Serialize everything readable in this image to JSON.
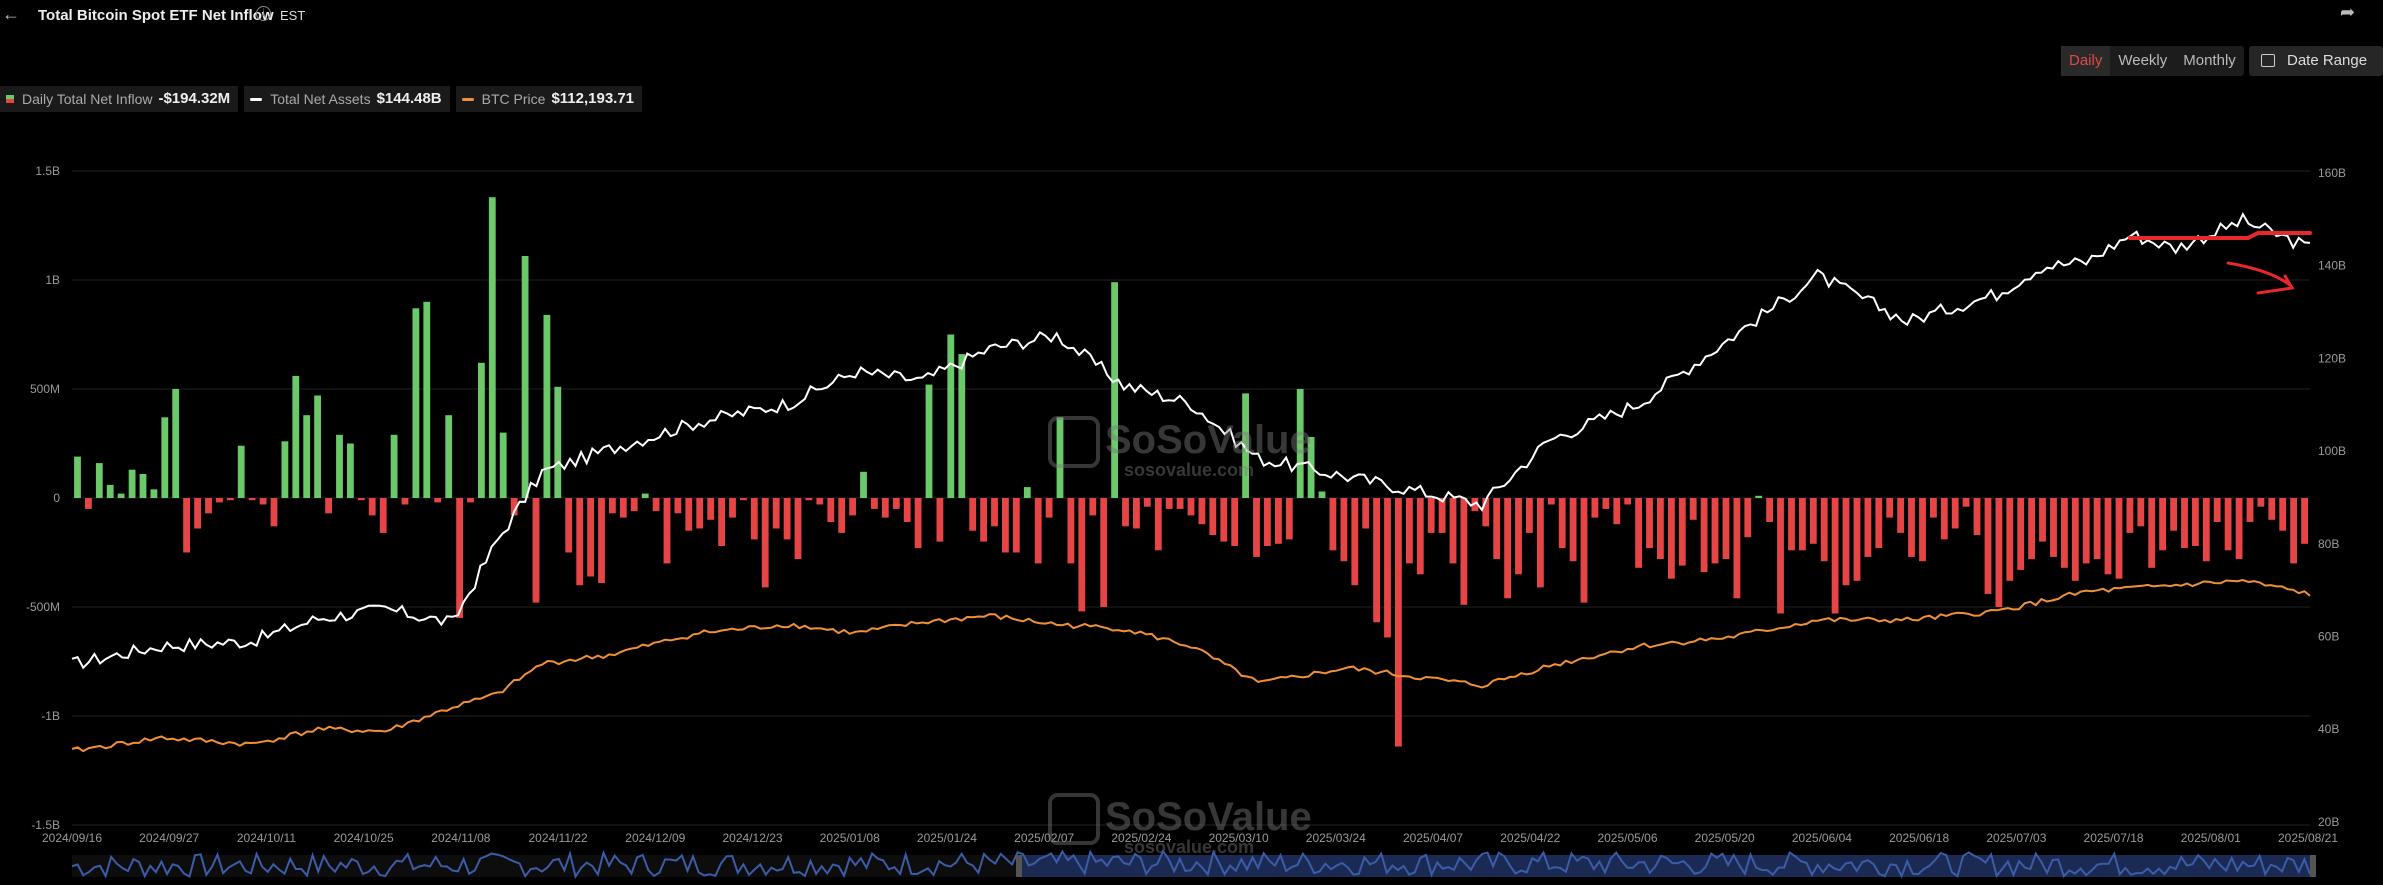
{
  "header": {
    "title": "Total Bitcoin Spot ETF Net Inflow",
    "timezone": "EST",
    "back_icon": "arrow-left-icon",
    "info_icon": "info-icon",
    "share_icon": "share-icon"
  },
  "tabs": [
    {
      "label": "Daily",
      "active": true
    },
    {
      "label": "Weekly",
      "active": false
    },
    {
      "label": "Monthly",
      "active": false
    }
  ],
  "date_range": {
    "label": "Date Range",
    "icon": "calendar-icon"
  },
  "legend": [
    {
      "label": "Daily Total Net Inflow",
      "value": "-$194.32M",
      "color": "#6cc96a"
    },
    {
      "label": "Total Net Assets",
      "value": "$144.48B",
      "color": "#ffffff"
    },
    {
      "label": "BTC Price",
      "value": "$112,193.71",
      "color": "#f0913a"
    }
  ],
  "watermark": {
    "brand": "SoSoValue",
    "url": "sosovalue.com"
  },
  "colors": {
    "positive": "#6cc96a",
    "negative": "#e64545",
    "assets": "#ffffff",
    "price": "#f0913a",
    "annotation": "#e8282a"
  },
  "chart_data": {
    "type": "bar",
    "title": "Total Bitcoin Spot ETF Net Inflow",
    "x_tick_labels": [
      "2024/09/16",
      "2024/09/27",
      "2024/10/11",
      "2024/10/25",
      "2024/11/08",
      "2024/11/22",
      "2024/12/09",
      "2024/12/23",
      "2025/01/08",
      "2025/01/24",
      "2025/02/07",
      "2025/02/24",
      "2025/03/10",
      "2025/03/24",
      "2025/04/07",
      "2025/04/22",
      "2025/05/06",
      "2025/05/20",
      "2025/06/04",
      "2025/06/18",
      "2025/07/03",
      "2025/07/18",
      "2025/08/01",
      "2025/08/21"
    ],
    "y_left": {
      "ticks": [
        "1.5B",
        "1B",
        "500M",
        "0",
        "-500M",
        "-1B",
        "-1.5B"
      ],
      "range": [
        -1500,
        1500
      ],
      "unit": "M USD"
    },
    "y_right": {
      "ticks": [
        "160B",
        "140B",
        "120B",
        "100B",
        "80B",
        "60B",
        "40B",
        "20B"
      ],
      "range": [
        20,
        160
      ],
      "unit": "B USD"
    },
    "series": [
      {
        "name": "Daily Total Net Inflow",
        "kind": "bar",
        "values": [
          190,
          -50,
          160,
          60,
          20,
          130,
          110,
          40,
          370,
          500,
          -250,
          -140,
          -70,
          -20,
          -10,
          240,
          -10,
          -30,
          -130,
          260,
          560,
          380,
          470,
          -70,
          290,
          250,
          -10,
          -80,
          -160,
          290,
          -30,
          870,
          900,
          -20,
          380,
          -550,
          -20,
          620,
          1380,
          300,
          -80,
          1110,
          -480,
          840,
          510,
          -250,
          -400,
          -360,
          -390,
          -70,
          -90,
          -60,
          20,
          -60,
          -300,
          -70,
          -150,
          -140,
          -100,
          -220,
          -90,
          -10,
          -190,
          -410,
          -140,
          -190,
          -280,
          -10,
          -30,
          -110,
          -160,
          -80,
          120,
          -50,
          -90,
          -50,
          -110,
          -230,
          520,
          -200,
          750,
          660,
          -150,
          -200,
          -130,
          -250,
          -250,
          50,
          -300,
          -90,
          370,
          -300,
          -520,
          -80,
          -500,
          990,
          -130,
          -140,
          -40,
          -240,
          -50,
          -50,
          -80,
          -120,
          -170,
          -200,
          -220,
          480,
          -270,
          -220,
          -210,
          -190,
          500,
          280,
          30,
          -240,
          -290,
          -400,
          -140,
          -570,
          -640,
          -1140,
          -300,
          -350,
          -160,
          -160,
          -300,
          -490,
          -60,
          -130,
          -280,
          -460,
          -350,
          -160,
          -410,
          -30,
          -230,
          -290,
          -480,
          -90,
          -50,
          -120,
          -30,
          -320,
          -230,
          -280,
          -370,
          -310,
          -100,
          -340,
          -300,
          -280,
          -460,
          -180,
          10,
          -110,
          -530,
          -240,
          -240,
          -210,
          -290,
          -530,
          -400,
          -380,
          -270,
          -230,
          -90,
          -160,
          -270,
          -290,
          -90,
          -190,
          -140,
          -40,
          -170,
          -440,
          -500,
          -380,
          -330,
          -280,
          -200,
          -270,
          -320,
          -380,
          -300,
          -280,
          -350,
          -370,
          -160,
          -130,
          -320,
          -240,
          -150,
          -230,
          -220,
          -290,
          -110,
          -240,
          -280,
          -110,
          -40,
          -100,
          -150,
          -300,
          -210
        ],
        "note": "values in millions USD; approximate reading of bars"
      },
      {
        "name": "Total Net Assets",
        "kind": "line",
        "axis": "right",
        "summary": "rises from ~53B (Sep 2024) to ~125B (late Jan 2025), dips to ~90B (early Apr 2025), climbs to ~155B (mid Aug 2025), ends ~144B"
      },
      {
        "name": "BTC Price",
        "kind": "line",
        "axis": "left-scaled",
        "summary": "rises from ~$58K (Sep 2024) to ~$106K (Jan 2025), dips to ~$77K (Apr 2025), peaks ~$123K (Aug 2025), ends ~$112K"
      }
    ],
    "grid": true,
    "legend_position": "top-left"
  }
}
